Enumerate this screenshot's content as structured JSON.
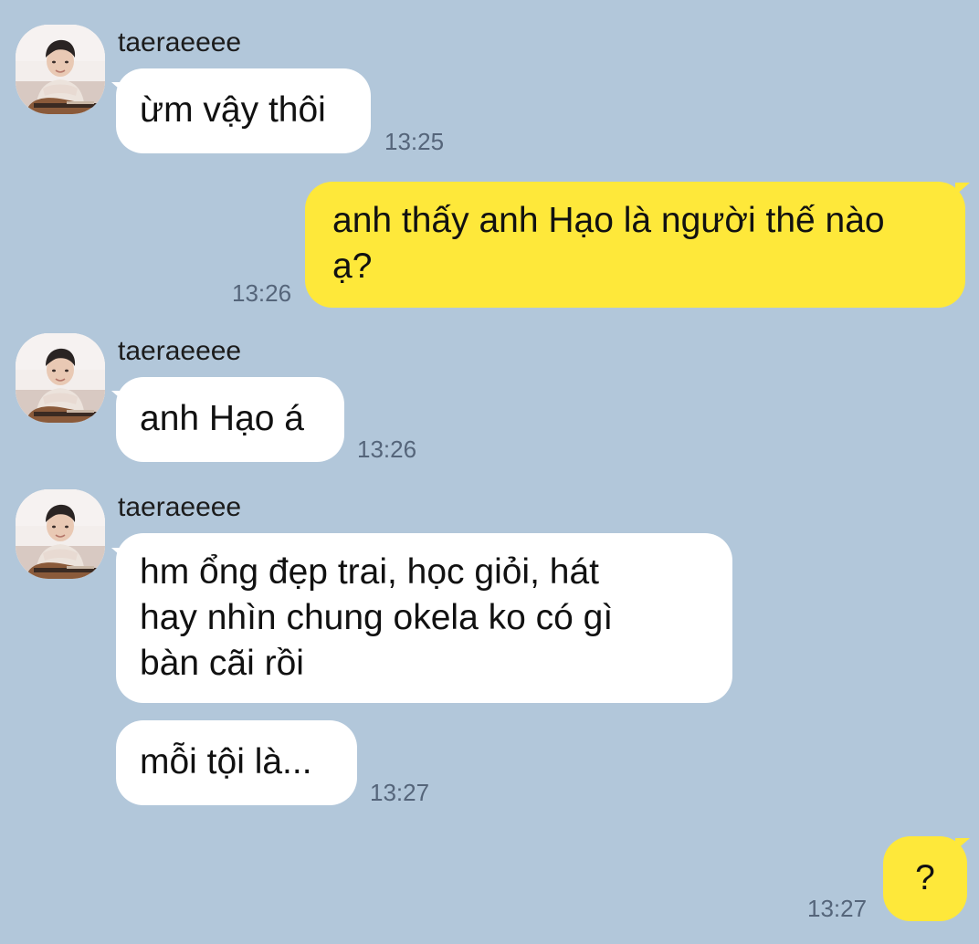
{
  "theme": {
    "background": "#b2c7da",
    "incoming_bubble": "#ffffff",
    "outgoing_bubble": "#fee83a",
    "timestamp_color": "#55657a"
  },
  "messages": [
    {
      "sender": "taeraeeee",
      "text": "ừm vậy thôi",
      "time": "13:25",
      "direction": "incoming"
    },
    {
      "text_lines": [
        "anh thấy anh Hạo là người thế nào",
        "ạ?"
      ],
      "time": "13:26",
      "direction": "outgoing"
    },
    {
      "sender": "taeraeeee",
      "text": "anh Hạo á",
      "time": "13:26",
      "direction": "incoming"
    },
    {
      "sender": "taeraeeee",
      "text_lines": [
        "hm ổng đẹp trai, học giỏi, hát",
        "hay nhìn chung okela ko có gì",
        "bàn cãi rồi"
      ],
      "direction": "incoming"
    },
    {
      "text": "mỗi tội là...",
      "time": "13:27",
      "direction": "incoming"
    },
    {
      "text": "?",
      "time": "13:27",
      "direction": "outgoing"
    }
  ]
}
